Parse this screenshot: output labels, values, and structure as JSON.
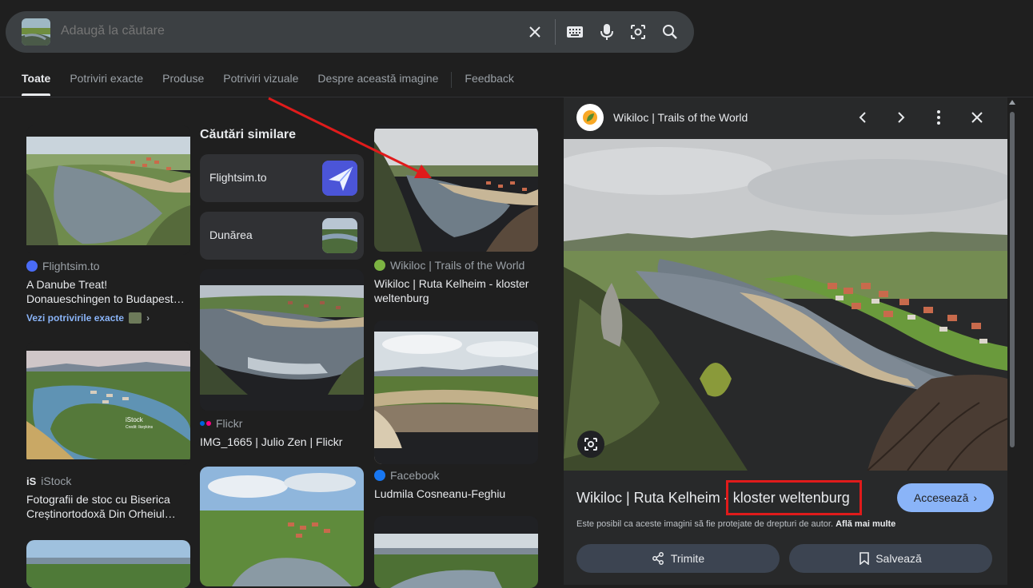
{
  "search": {
    "placeholder": "Adaugă la căutare"
  },
  "tabs": [
    {
      "label": "Toate"
    },
    {
      "label": "Potriviri exacte"
    },
    {
      "label": "Produse"
    },
    {
      "label": "Potriviri vizuale"
    },
    {
      "label": "Despre această imagine"
    },
    {
      "label": "Feedback"
    }
  ],
  "results": {
    "r1": {
      "source": "Flightsim.to",
      "title": "A Danube Treat! Donaueschingen to Budapest…",
      "exact_link": "Vezi potrivirile exacte"
    },
    "r2": {
      "source": "iStock",
      "title": "Fotografii de stoc cu Biserica Creștinortodoxă Din Orheiul…",
      "source_glyph": "iS",
      "watermark": "iStock",
      "watermark_credit": "Credit: Ikeykins"
    },
    "similar": {
      "heading": "Căutări similare",
      "chips": [
        {
          "label": "Flightsim.to"
        },
        {
          "label": "Dunărea"
        }
      ]
    },
    "r3": {
      "source": "Flickr",
      "title": "IMG_1665 | Julio Zen | Flickr"
    },
    "r4": {
      "source": "Wikiloc | Trails of the World",
      "title": "Wikiloc | Ruta Kelheim - kloster weltenburg"
    },
    "r5": {
      "source": "Facebook",
      "title": "Ludmila Cosneanu-Feghiu"
    }
  },
  "panel": {
    "site": "Wikiloc | Trails of the World",
    "title_prefix": "Wikiloc | Ruta Kelheim - ",
    "title_highlight": "kloster weltenburg",
    "visit_label": "Accesează",
    "copyright_text": "Este posibil ca aceste imagini să fie protejate de drepturi de autor.",
    "learn_more": "Află mai multe",
    "share_label": "Trimite",
    "save_label": "Salvează"
  },
  "colors": {
    "accent": "#8ab4f8",
    "highlight_box": "#e01b1b",
    "annotation_arrow": "#e01b1b"
  }
}
